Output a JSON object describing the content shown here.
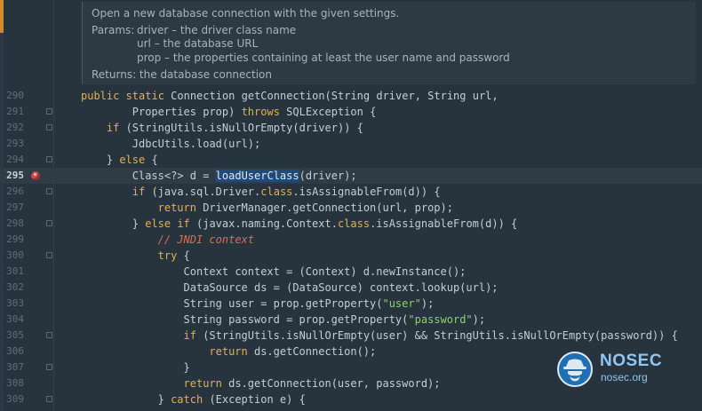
{
  "doc": {
    "summary": "Open a new database connection with the given settings.",
    "params_label": "Params:",
    "params": [
      "driver – the driver class name",
      "url – the database URL",
      "prop – the properties containing at least the user name and password"
    ],
    "returns": "Returns: the database connection"
  },
  "code_lines": [
    {
      "n": "290",
      "indent": 0,
      "fold": false,
      "tokens": [
        [
          "kw",
          "public static "
        ],
        [
          "t",
          "Connection getConnection(String driver, String url,"
        ]
      ]
    },
    {
      "n": "291",
      "indent": 8,
      "fold": true,
      "tokens": [
        [
          "t",
          "Properties prop) "
        ],
        [
          "kw",
          "throws "
        ],
        [
          "t",
          "SQLException {"
        ]
      ]
    },
    {
      "n": "292",
      "indent": 4,
      "fold": true,
      "tokens": [
        [
          "kw",
          "if "
        ],
        [
          "t",
          "(StringUtils.isNullOrEmpty(driver)) {"
        ]
      ]
    },
    {
      "n": "293",
      "indent": 8,
      "fold": false,
      "tokens": [
        [
          "t",
          "JdbcUtils.load(url);"
        ]
      ]
    },
    {
      "n": "294",
      "indent": 4,
      "fold": true,
      "tokens": [
        [
          "t",
          "} "
        ],
        [
          "kw",
          "else "
        ],
        [
          "t",
          "{"
        ]
      ]
    },
    {
      "n": "295",
      "indent": 8,
      "fold": false,
      "current": true,
      "breakpoint": true,
      "tokens": [
        [
          "t",
          "Class<?> d = "
        ],
        [
          "sel",
          "loadUserClass"
        ],
        [
          "t",
          "(driver);"
        ]
      ]
    },
    {
      "n": "296",
      "indent": 8,
      "fold": true,
      "tokens": [
        [
          "kw",
          "if "
        ],
        [
          "t",
          "(java.sql.Driver."
        ],
        [
          "kw",
          "class"
        ],
        [
          "t",
          ".isAssignableFrom(d)) {"
        ]
      ]
    },
    {
      "n": "297",
      "indent": 12,
      "fold": false,
      "tokens": [
        [
          "kw",
          "return "
        ],
        [
          "t",
          "DriverManager.getConnection(url, prop);"
        ]
      ]
    },
    {
      "n": "298",
      "indent": 8,
      "fold": true,
      "tokens": [
        [
          "t",
          "} "
        ],
        [
          "kw",
          "else if "
        ],
        [
          "t",
          "(javax.naming.Context."
        ],
        [
          "kw",
          "class"
        ],
        [
          "t",
          ".isAssignableFrom(d)) {"
        ]
      ]
    },
    {
      "n": "299",
      "indent": 12,
      "fold": false,
      "tokens": [
        [
          "cmt",
          "// JNDI context"
        ]
      ]
    },
    {
      "n": "300",
      "indent": 12,
      "fold": true,
      "tokens": [
        [
          "kw",
          "try "
        ],
        [
          "t",
          "{"
        ]
      ]
    },
    {
      "n": "301",
      "indent": 16,
      "fold": false,
      "tokens": [
        [
          "t",
          "Context context = (Context) d.newInstance();"
        ]
      ]
    },
    {
      "n": "302",
      "indent": 16,
      "fold": false,
      "tokens": [
        [
          "t",
          "DataSource ds = (DataSource) context.lookup(url);"
        ]
      ]
    },
    {
      "n": "303",
      "indent": 16,
      "fold": false,
      "tokens": [
        [
          "t",
          "String user = prop.getProperty("
        ],
        [
          "str",
          "\"user\""
        ],
        [
          "t",
          ");"
        ]
      ]
    },
    {
      "n": "304",
      "indent": 16,
      "fold": false,
      "tokens": [
        [
          "t",
          "String password = prop.getProperty("
        ],
        [
          "str",
          "\"password\""
        ],
        [
          "t",
          ");"
        ]
      ]
    },
    {
      "n": "305",
      "indent": 16,
      "fold": true,
      "tokens": [
        [
          "kw",
          "if "
        ],
        [
          "t",
          "(StringUtils.isNullOrEmpty(user) && StringUtils.isNullOrEmpty(password)) {"
        ]
      ]
    },
    {
      "n": "306",
      "indent": 20,
      "fold": false,
      "tokens": [
        [
          "kw",
          "return "
        ],
        [
          "t",
          "ds.getConnection();"
        ]
      ]
    },
    {
      "n": "307",
      "indent": 16,
      "fold": true,
      "tokens": [
        [
          "t",
          "}"
        ]
      ]
    },
    {
      "n": "308",
      "indent": 16,
      "fold": false,
      "tokens": [
        [
          "kw",
          "return "
        ],
        [
          "t",
          "ds.getConnection(user, password);"
        ]
      ]
    },
    {
      "n": "309",
      "indent": 12,
      "fold": true,
      "tokens": [
        [
          "t",
          "} "
        ],
        [
          "kw",
          "catch "
        ],
        [
          "t",
          "(Exception e) {"
        ]
      ]
    }
  ],
  "brand": {
    "title": "NOSEC",
    "subtitle": "nosec.org",
    "icon": "spy-hat-icon",
    "accent": "#8fc7f2"
  },
  "colors": {
    "background": "#27333d",
    "keyword": "#e3b24a",
    "string": "#8fd16e",
    "comment": "#e06c4b",
    "selection": "#214a78"
  }
}
